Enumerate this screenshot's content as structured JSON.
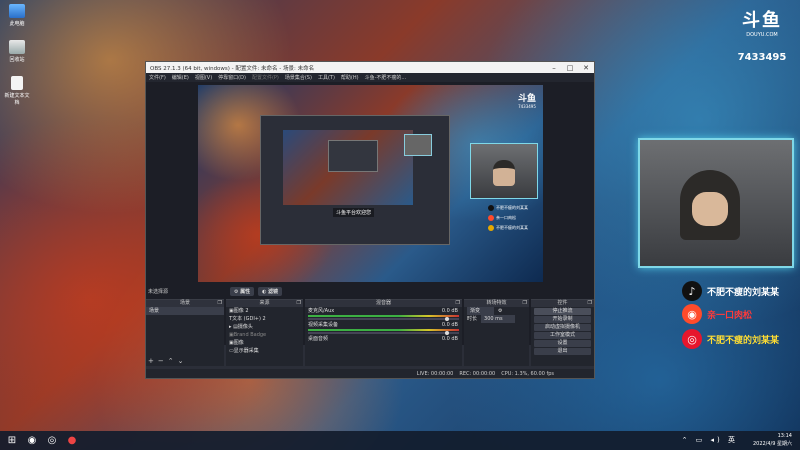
{
  "desktop": {
    "icons": [
      {
        "label": "此电脑",
        "icon": "computer-icon"
      },
      {
        "label": "回收站",
        "icon": "recycle-bin-icon"
      },
      {
        "label": "新建文本文档",
        "icon": "text-file-icon"
      }
    ]
  },
  "brand": {
    "logo": "斗鱼",
    "site": "DOUYU.COM",
    "room_id": "7433495"
  },
  "socials": [
    {
      "icon": "tiktok-icon",
      "label": "不肥不瘦的刘某某",
      "color": "#ffffff",
      "bg": "#111111"
    },
    {
      "icon": "kuaishou-icon",
      "label": "亲一口肉松",
      "color": "#ff3a3a",
      "bg": "#ff4b2b"
    },
    {
      "icon": "weibo-icon",
      "label": "不肥不瘦的刘某某",
      "color": "#ffdd33",
      "bg": "#e6162d"
    }
  ],
  "obs": {
    "title": "OBS 27.1.3 (64 bit, windows) - 配置文件: 未命名 - 场景: 未命名",
    "menu": [
      "文件(F)",
      "编辑(E)",
      "视图(V)",
      "停靠窗口(D)",
      "配置文件(P)",
      "场景集合(S)",
      "工具(T)",
      "帮助(H)",
      "斗鱼-不肥不瘦的..."
    ],
    "canvas": {
      "logo": "斗鱼",
      "room_id": "7433495",
      "ad_text": "斗鱼平台欢迎您",
      "mini_socials": [
        {
          "label": "不肥不瘦的刘某某",
          "color": "#111111"
        },
        {
          "label": "亲一口肉松",
          "color": "#ff4b2b"
        },
        {
          "label": "不肥不瘦的刘某某",
          "color": "#e6a800"
        }
      ]
    },
    "preview_toolbar": {
      "props": "属性",
      "filters": "滤镜"
    },
    "no_source": "未选择源",
    "scenes": {
      "header": "场景",
      "items": [
        "场景"
      ]
    },
    "sources": {
      "header": "来源",
      "items": [
        {
          "name": "图像 2"
        },
        {
          "name": "文本 (GDI+) 2"
        },
        {
          "name": "摄像头"
        },
        {
          "name": "Brand Badge"
        },
        {
          "name": "图像"
        },
        {
          "name": "显示器采集"
        }
      ]
    },
    "mixer": {
      "header": "混音器",
      "channels": [
        {
          "name": "麦克风/Aux",
          "db": "0.0 dB"
        },
        {
          "name": "视频采集设备",
          "db": "0.0 dB"
        },
        {
          "name": "桌面音频",
          "db": "0.0 dB"
        }
      ]
    },
    "transitions": {
      "header": "转场特效",
      "type": "渐变",
      "duration_label": "时长",
      "duration": "300 ms"
    },
    "controls": {
      "header": "控件",
      "buttons": [
        "停止推流",
        "开始录制",
        "启动虚拟摄像机",
        "工作室模式",
        "设置",
        "退出"
      ]
    },
    "status": {
      "live": "LIVE: 00:00:00",
      "rec": "REC: 00:00:00",
      "cpu": "CPU: 1.3%, 60.00 fps"
    }
  },
  "taskbar": {
    "time": "13:14",
    "date": "2022/4/9 星期六"
  }
}
